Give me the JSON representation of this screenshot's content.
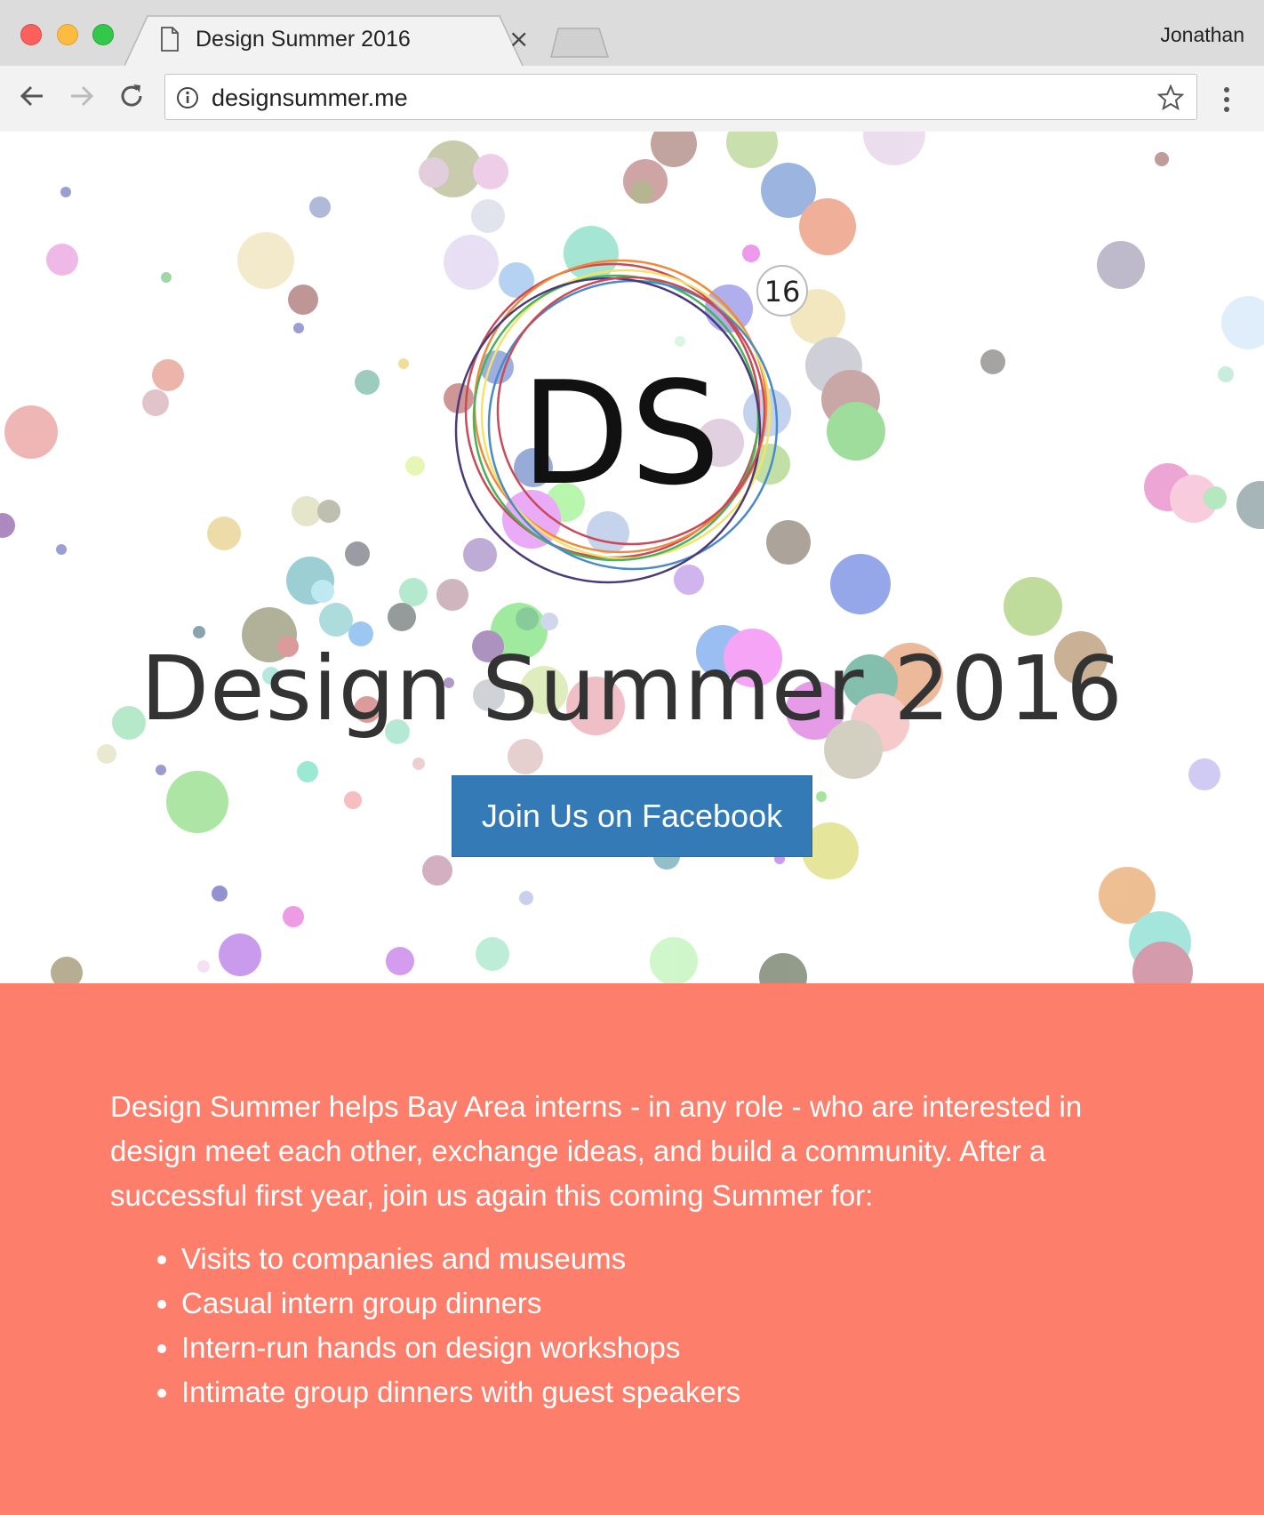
{
  "browser": {
    "tab_title": "Design Summer 2016",
    "close_glyph": "×",
    "user_name": "Jonathan",
    "url": "designsummer.me",
    "icons": [
      "back-icon",
      "forward-icon",
      "reload-icon",
      "info-icon",
      "star-icon",
      "menu-icon",
      "document-icon",
      "close-icon"
    ]
  },
  "hero": {
    "logo_text": "DS",
    "logo_badge": "16",
    "title": "Design Summer 2016",
    "facebook_button": "Join Us on Facebook"
  },
  "about": {
    "intro": "Design Summer helps Bay Area interns - in any role - who are interested in design meet each other, exchange ideas, and build a community. After a successful first year, join us again this coming Summer for:",
    "items": [
      "Visits to companies and museums",
      "Casual intern group dinners",
      "Intern-run hands on design workshops",
      "Intimate group dinners with guest speakers"
    ]
  },
  "colors": {
    "primary_button": "#337ab7",
    "section_background": "#fd7e6a"
  }
}
